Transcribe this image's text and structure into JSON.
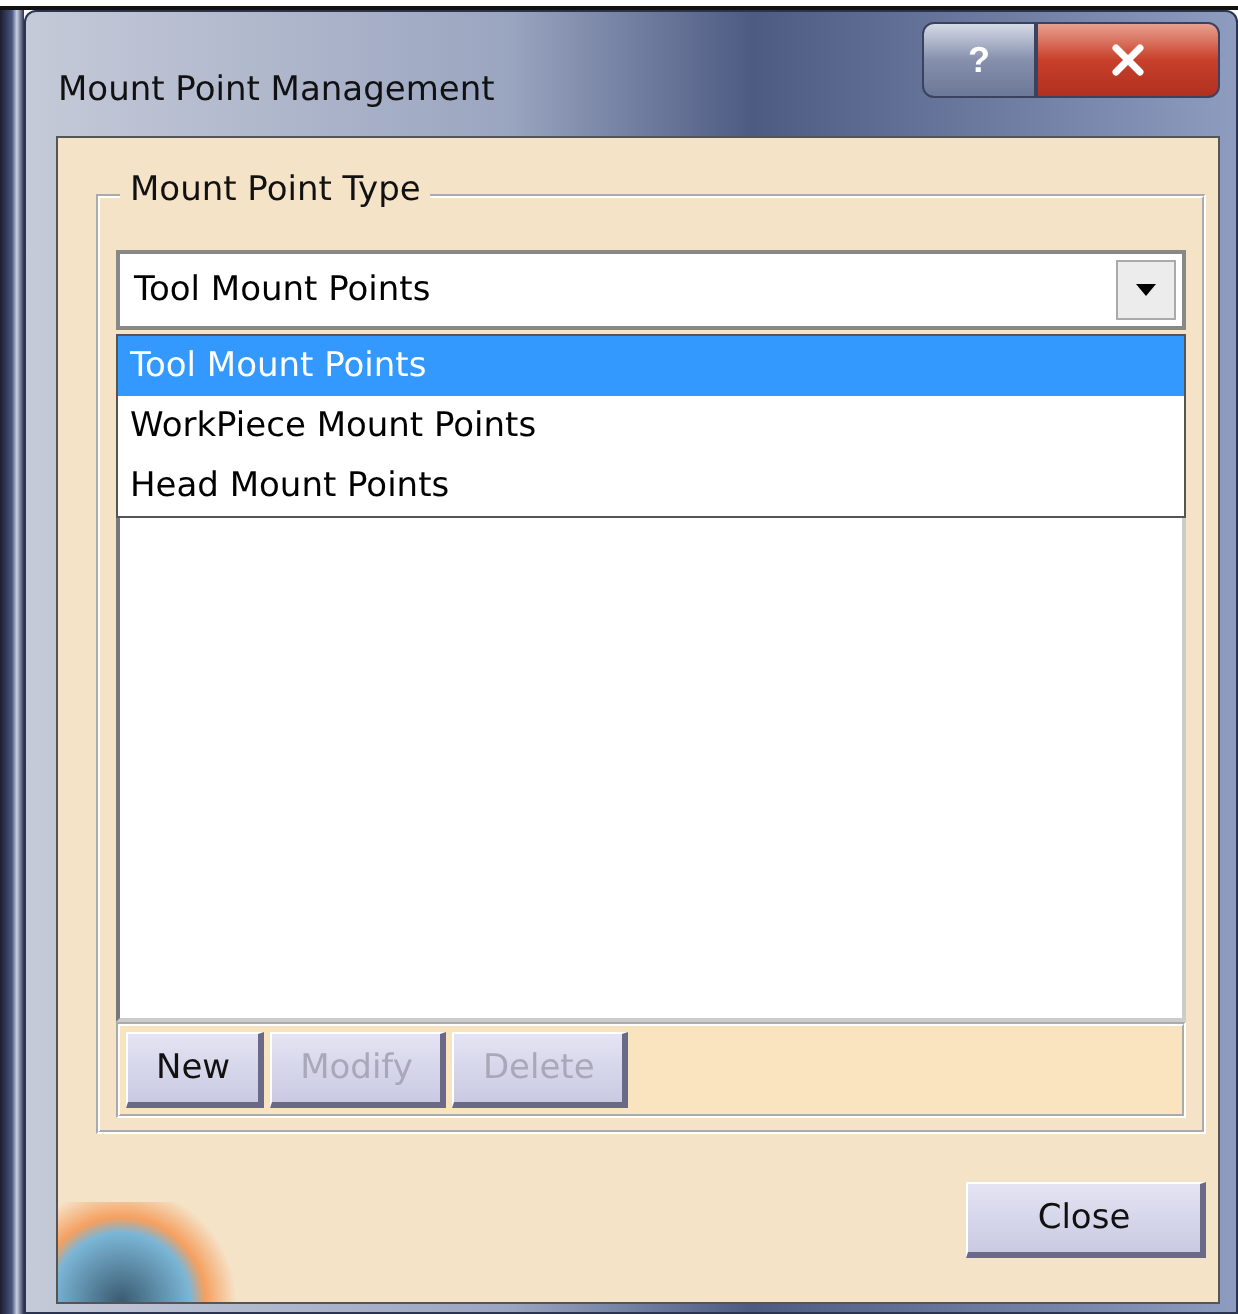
{
  "window": {
    "title": "Mount Point Management",
    "help": "?"
  },
  "group": {
    "label": "Mount Point Type"
  },
  "combo": {
    "value": "Tool Mount Points",
    "expanded": true
  },
  "options": [
    {
      "label": "Tool Mount Points",
      "selected": true
    },
    {
      "label": "WorkPiece Mount Points",
      "selected": false
    },
    {
      "label": "Head Mount Points",
      "selected": false
    }
  ],
  "buttons": [
    {
      "label": "New",
      "disabled": false
    },
    {
      "label": "Modify",
      "disabled": true
    },
    {
      "label": "Delete",
      "disabled": true
    }
  ],
  "close": "Close"
}
